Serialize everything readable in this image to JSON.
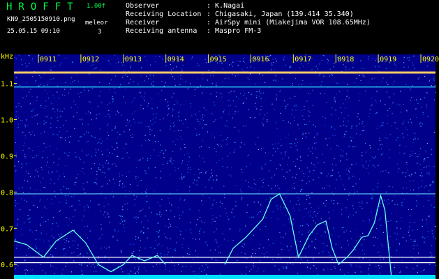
{
  "header": {
    "brand": "HROFFT",
    "version": "1.00f",
    "filename": "KN9_2505150910.png",
    "mode": "meleor",
    "datetime": "25.05.15 09:10",
    "counter": "3"
  },
  "info": [
    {
      "label": "Observer",
      "value": ": K.Nagai"
    },
    {
      "label": "Receiving Location",
      "value": ": Chigasaki, Japan (139.414 35.340)"
    },
    {
      "label": "Receiver",
      "value": ": AirSpy mini (Miakejima VOR 108.65MHz)"
    },
    {
      "label": "Receiving antenna",
      "value": ": Maspro FM-3"
    }
  ],
  "colors": {
    "background": "#00008b",
    "text_green": "#00ff44",
    "text_yellow": "#ffff00",
    "trace": "#66ffee"
  },
  "chart_data": {
    "type": "heatmap",
    "ylabel": "kHz",
    "ylim": [
      0.56,
      1.18
    ],
    "y_ticks": [
      0.6,
      0.7,
      0.8,
      0.9,
      1.0,
      1.1
    ],
    "x_ticks": [
      "0911",
      "0912",
      "0913",
      "0914",
      "0915",
      "0916",
      "0917",
      "0918",
      "0919",
      "0920"
    ],
    "constant_lines_khz": [
      1.13,
      1.09,
      0.795,
      0.62,
      0.605
    ],
    "echo_trace": [
      [
        0,
        0.665
      ],
      [
        0.03,
        0.655
      ],
      [
        0.07,
        0.62
      ],
      [
        0.1,
        0.665
      ],
      [
        0.14,
        0.695
      ],
      [
        0.17,
        0.66
      ],
      [
        0.2,
        0.6
      ],
      [
        0.23,
        0.58
      ],
      [
        0.26,
        0.6
      ],
      [
        0.28,
        0.625
      ],
      [
        0.31,
        0.61
      ],
      [
        0.34,
        0.625
      ],
      [
        0.36,
        0.6
      ],
      [
        0.5,
        0.6
      ],
      [
        0.52,
        0.645
      ],
      [
        0.55,
        0.675
      ],
      [
        0.57,
        0.7
      ],
      [
        0.59,
        0.725
      ],
      [
        0.61,
        0.78
      ],
      [
        0.63,
        0.795
      ],
      [
        0.655,
        0.735
      ],
      [
        0.675,
        0.62
      ],
      [
        0.7,
        0.68
      ],
      [
        0.72,
        0.71
      ],
      [
        0.74,
        0.72
      ],
      [
        0.755,
        0.645
      ],
      [
        0.77,
        0.6
      ],
      [
        0.79,
        0.62
      ],
      [
        0.805,
        0.64
      ],
      [
        0.825,
        0.675
      ],
      [
        0.84,
        0.68
      ],
      [
        0.855,
        0.715
      ],
      [
        0.87,
        0.79
      ],
      [
        0.88,
        0.75
      ],
      [
        0.895,
        0.57
      ]
    ]
  }
}
